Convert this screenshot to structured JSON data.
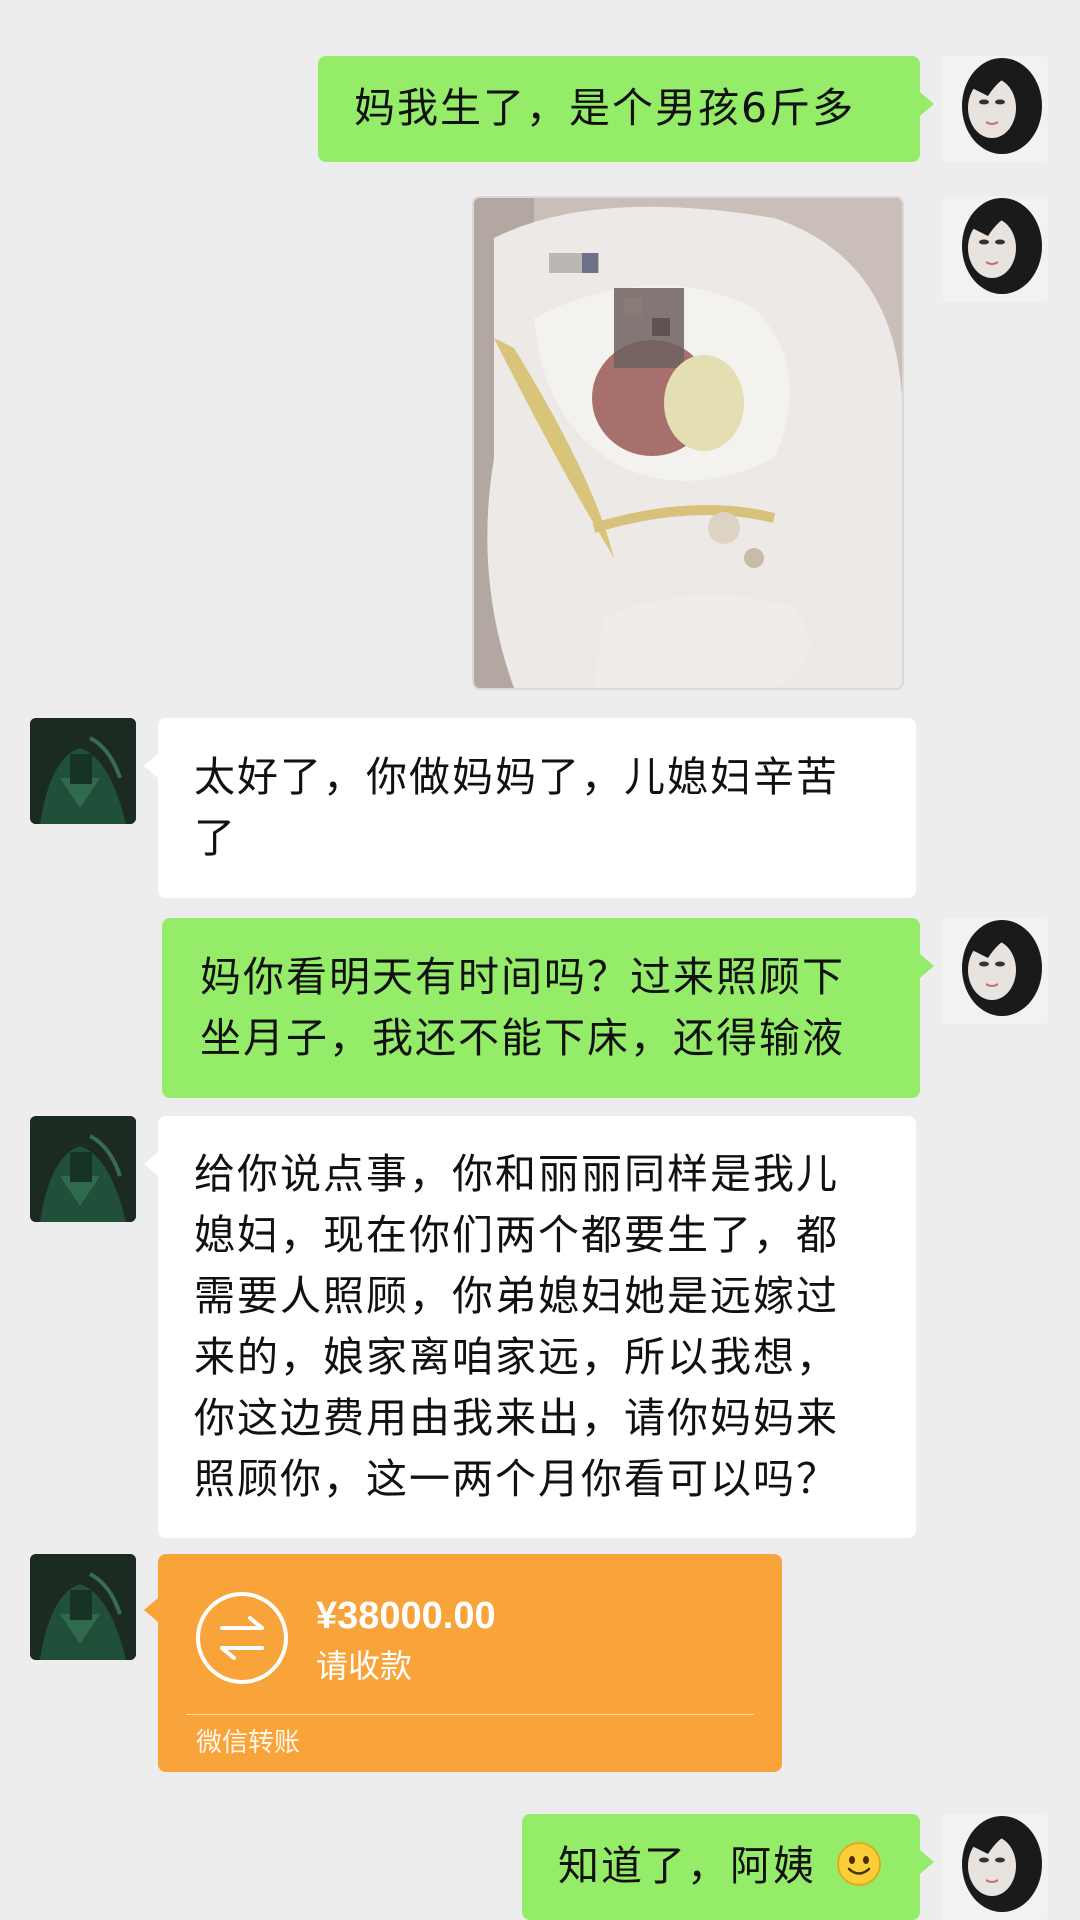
{
  "messages": [
    {
      "sender": "self",
      "type": "text",
      "text": "妈我生了，是个男孩6斤多"
    },
    {
      "sender": "self",
      "type": "image",
      "description": "newborn-photo"
    },
    {
      "sender": "other",
      "type": "text",
      "lines": [
        "太好了，你做妈妈了，儿媳妇辛苦",
        "了"
      ]
    },
    {
      "sender": "self",
      "type": "text",
      "lines": [
        "妈你看明天有时间吗？过来照顾下",
        "坐月子，我还不能下床，还得输液"
      ]
    },
    {
      "sender": "other",
      "type": "text",
      "lines": [
        "给你说点事，你和丽丽同样是我儿",
        "媳妇，现在你们两个都要生了，都",
        "需要人照顾，你弟媳妇她是远嫁过",
        "来的，娘家离咱家远，所以我想，",
        "你这边费用由我来出，请你妈妈来",
        "照顾你，这一两个月你看可以吗？"
      ]
    },
    {
      "sender": "other",
      "type": "transfer",
      "amount": "¥38000.00",
      "note": "请收款",
      "footer": "微信转账",
      "icon": "transfer-arrows-icon"
    },
    {
      "sender": "self",
      "type": "text",
      "text": "知道了，阿姨",
      "emoji": "smile-emoji-icon"
    }
  ],
  "colors": {
    "background": "#ededed",
    "self_bubble": "#95ec69",
    "other_bubble": "#ffffff",
    "transfer": "#f8a43a"
  }
}
